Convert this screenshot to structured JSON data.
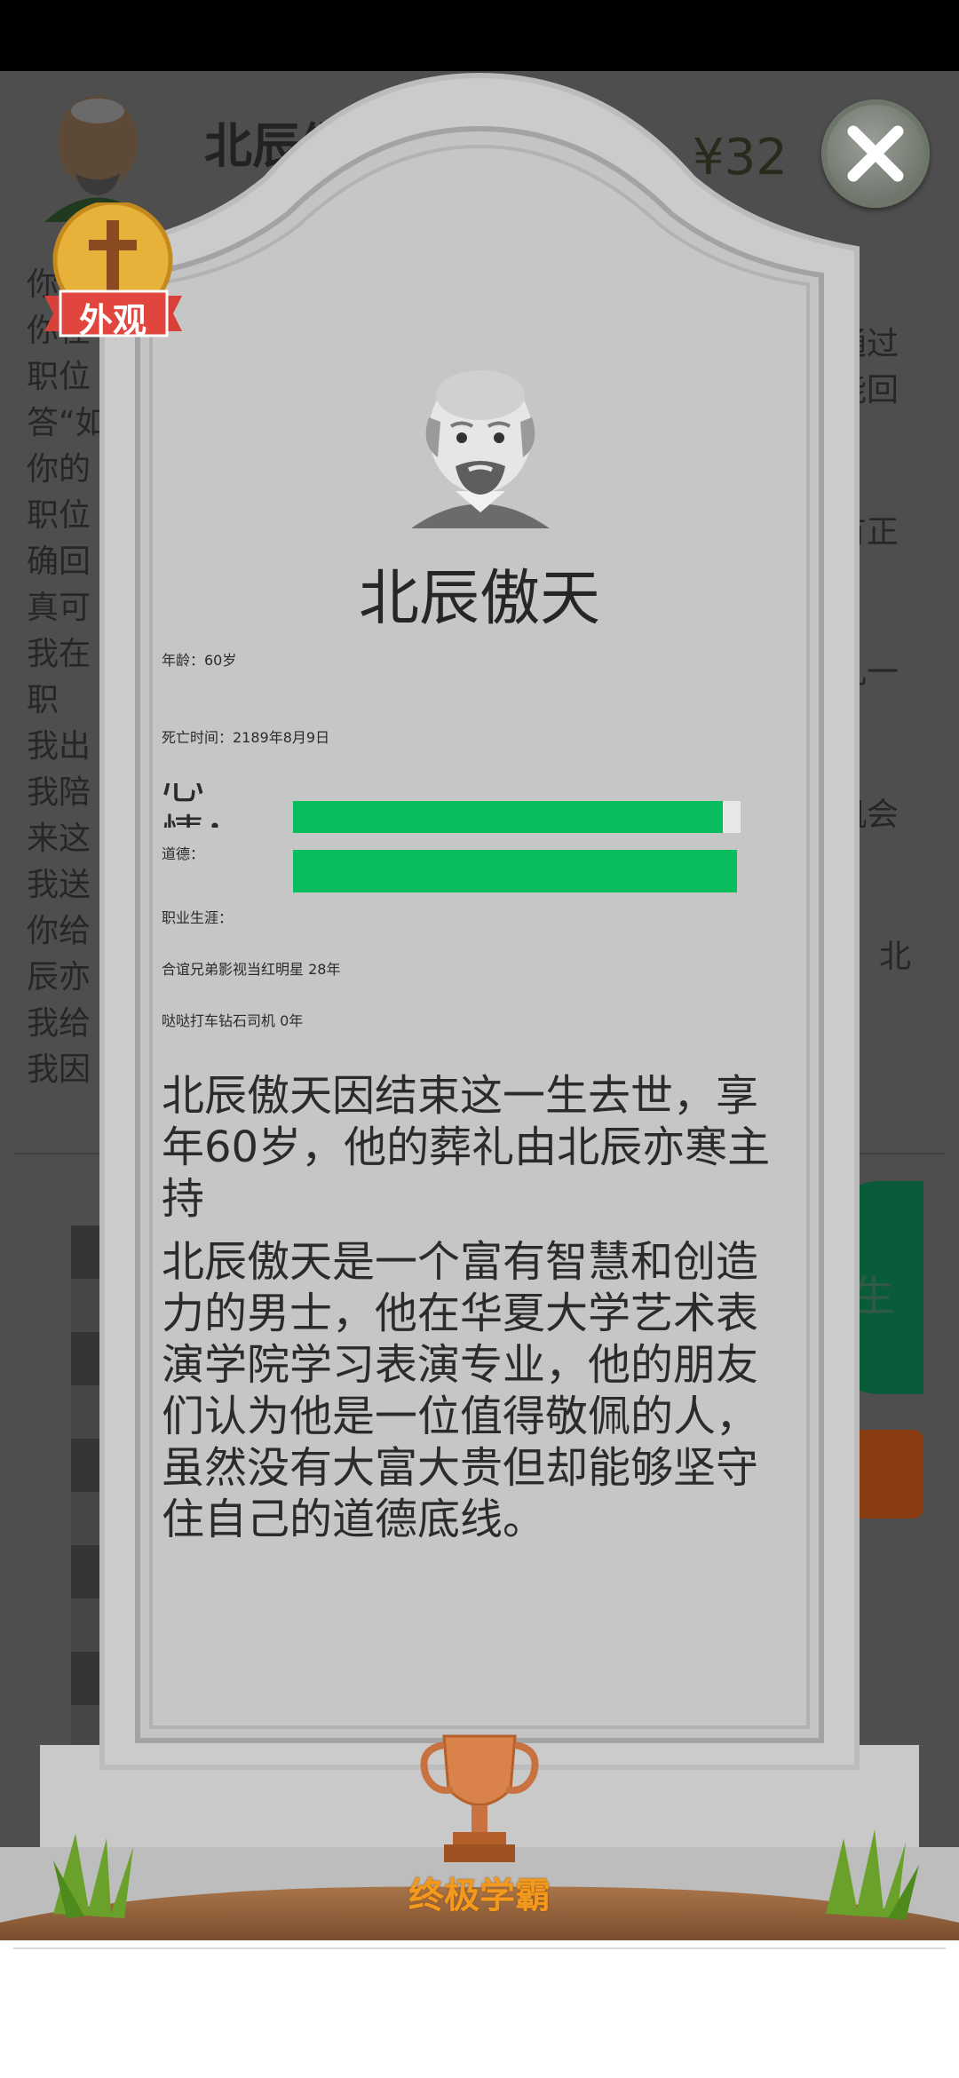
{
  "background": {
    "player_name": "北辰傲",
    "money": "¥32",
    "log_left": [
      "你",
      "你在",
      "职位",
      "答“如",
      "你的",
      "职位",
      "确回",
      "真可",
      "我在",
      "职",
      "我出",
      "我陪",
      "来这",
      "我送",
      "你给",
      "辰亦",
      "我给",
      "我因"
    ],
    "log_right": [
      "通过",
      "能回",
      "有正",
      "几一",
      "",
      "机会",
      "北"
    ],
    "side_button": "生"
  },
  "profile": {
    "badge_label": "外观",
    "name": "北辰傲天",
    "age": "年龄：60岁",
    "death_time": "死亡时间：2189年8月9日",
    "mood_label": "心情：",
    "mood_level": 0.96,
    "morality_label": "道德：",
    "morality_level": 1.0,
    "career_label": "职业生涯：",
    "career_1": "合谊兄弟影视当红明星 28年",
    "career_2": "哒哒打车钻石司机 0年",
    "summary": "北辰傲天因结束这一生去世，享年60岁，他的葬礼由北辰亦寒主持",
    "epitaph": "北辰傲天是一个富有智慧和创造力的男士，他在华夏大学艺术表演学院学习表演专业，他的朋友们认为他是一位值得敬佩的人，虽然没有大富大贵但却能够坚守住自己的道德底线。",
    "achievement": "终极学霸"
  },
  "colors": {
    "bar_green": "#07bd5c",
    "stone": "#c8c8c8",
    "achievement": "#f39a1e"
  }
}
